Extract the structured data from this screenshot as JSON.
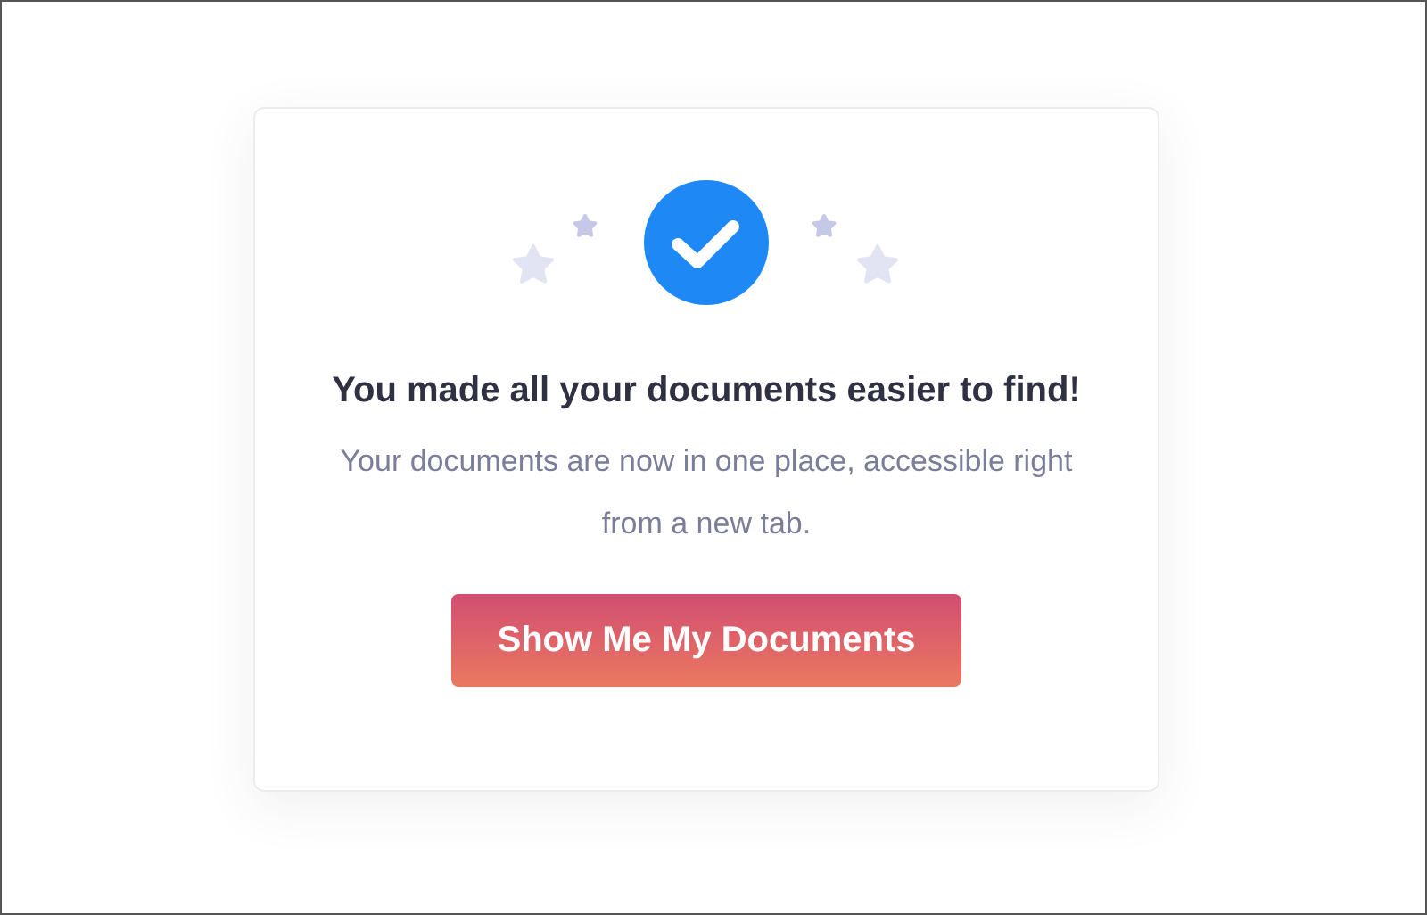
{
  "card": {
    "title": "You made all your documents easier to find!",
    "message": "Your documents are now in one place, accessible right from a new tab.",
    "button": "Show Me My Documents"
  }
}
